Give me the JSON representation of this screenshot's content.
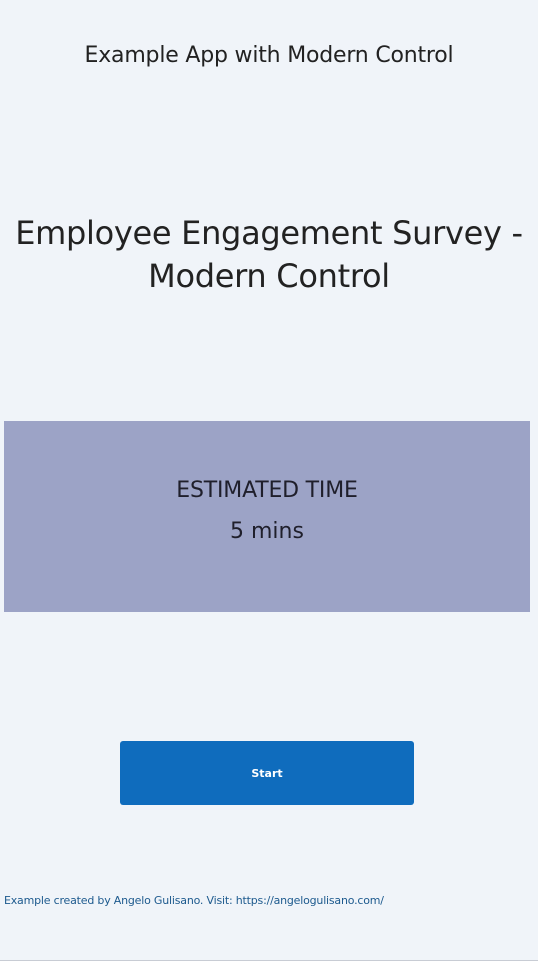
{
  "header": {
    "app_title": "Example App with Modern Control"
  },
  "survey": {
    "title": "Employee Engagement Survey - Modern Control"
  },
  "estimate": {
    "label": "ESTIMATED TIME",
    "value": "5 mins",
    "panel_color": "#9ca3c6"
  },
  "actions": {
    "start_label": "Start",
    "accent_color": "#0f6cbd"
  },
  "footer": {
    "note": "Example created by Angelo Gulisano. Visit: https://angelogulisano.com/"
  }
}
